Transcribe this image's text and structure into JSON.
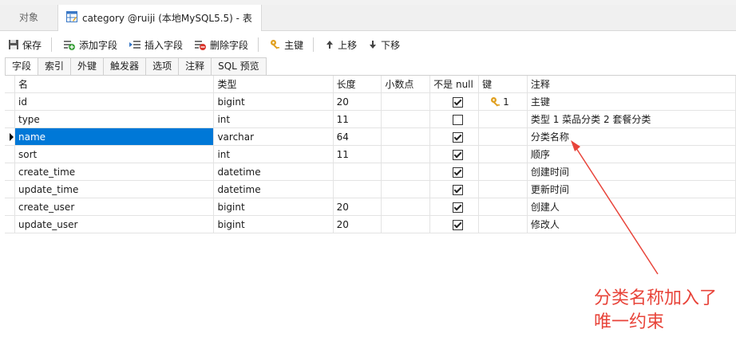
{
  "window": {
    "object_tab_label": "对象",
    "doc_tab_title": "category @ruiji (本地MySQL5.5) - 表"
  },
  "toolbar": {
    "save_label": "保存",
    "add_field_label": "添加字段",
    "insert_field_label": "插入字段",
    "delete_field_label": "删除字段",
    "primary_key_label": "主键",
    "move_up_label": "上移",
    "move_down_label": "下移"
  },
  "subtabs": [
    "字段",
    "索引",
    "外键",
    "触发器",
    "选项",
    "注释",
    "SQL 预览"
  ],
  "grid": {
    "headers": {
      "name": "名",
      "type": "类型",
      "length": "长度",
      "decimals": "小数点",
      "not_null": "不是 null",
      "key": "键",
      "comment": "注释"
    },
    "rows": [
      {
        "name": "id",
        "type": "bigint",
        "length": "20",
        "decimals": "",
        "not_null": true,
        "key": "1",
        "comment": "主键"
      },
      {
        "name": "type",
        "type": "int",
        "length": "11",
        "decimals": "",
        "not_null": false,
        "key": "",
        "comment": "类型   1 菜品分类 2 套餐分类"
      },
      {
        "name": "name",
        "type": "varchar",
        "length": "64",
        "decimals": "",
        "not_null": true,
        "key": "",
        "comment": "分类名称"
      },
      {
        "name": "sort",
        "type": "int",
        "length": "11",
        "decimals": "",
        "not_null": true,
        "key": "",
        "comment": "顺序"
      },
      {
        "name": "create_time",
        "type": "datetime",
        "length": "",
        "decimals": "",
        "not_null": true,
        "key": "",
        "comment": "创建时间"
      },
      {
        "name": "update_time",
        "type": "datetime",
        "length": "",
        "decimals": "",
        "not_null": true,
        "key": "",
        "comment": "更新时间"
      },
      {
        "name": "create_user",
        "type": "bigint",
        "length": "20",
        "decimals": "",
        "not_null": true,
        "key": "",
        "comment": "创建人"
      },
      {
        "name": "update_user",
        "type": "bigint",
        "length": "20",
        "decimals": "",
        "not_null": true,
        "key": "",
        "comment": "修改人"
      }
    ],
    "selected_row": 2
  },
  "annotation": {
    "line1": "分类名称加入了",
    "line2": "唯一约束",
    "color": "#e8443a"
  },
  "colors": {
    "selection": "#0078d7",
    "key_icon": "#e0a020"
  }
}
